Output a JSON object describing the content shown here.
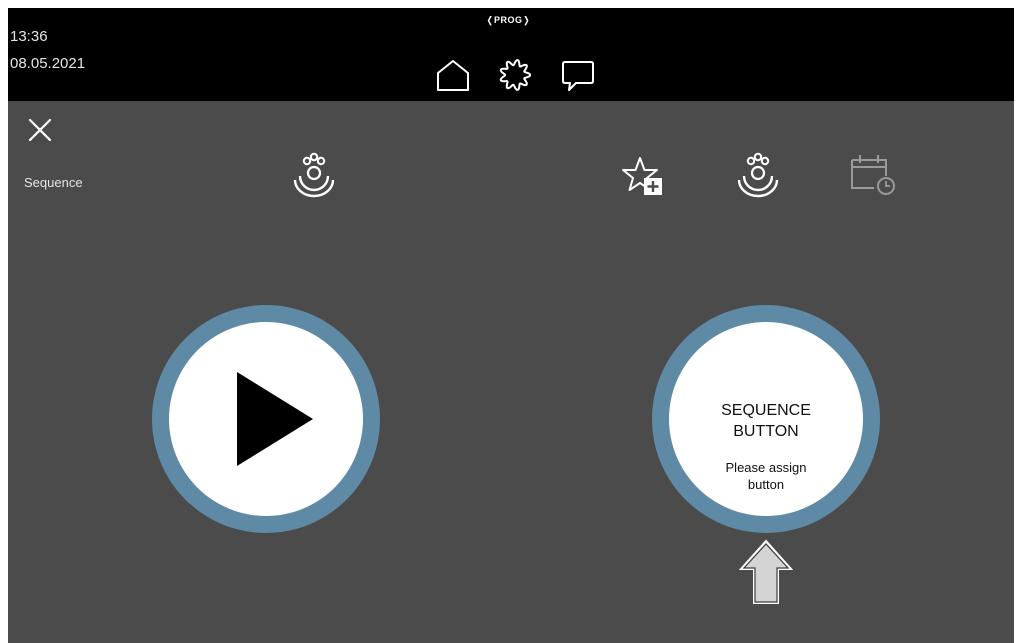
{
  "status": {
    "time": "13:36",
    "date": "08.05.2021",
    "prog_label": "PROG"
  },
  "nav": {
    "icons": [
      "home-icon",
      "gear-icon",
      "chat-icon"
    ]
  },
  "header": {
    "label": "Sequence"
  },
  "tools": {
    "icons": [
      "shower-icon",
      "favorite-add-icon",
      "shower-icon",
      "calendar-clock-icon"
    ]
  },
  "play_button": {
    "icon": "play-icon"
  },
  "sequence_button": {
    "title_line1": "SEQUENCE",
    "title_line2": "BUTTON",
    "sub_line1": "Please assign",
    "sub_line2": "button"
  },
  "colors": {
    "background": "#4b4b4b",
    "topbar": "#000000",
    "ring": "#5e8aa5",
    "disabled_icon": "#9a9a9a"
  }
}
